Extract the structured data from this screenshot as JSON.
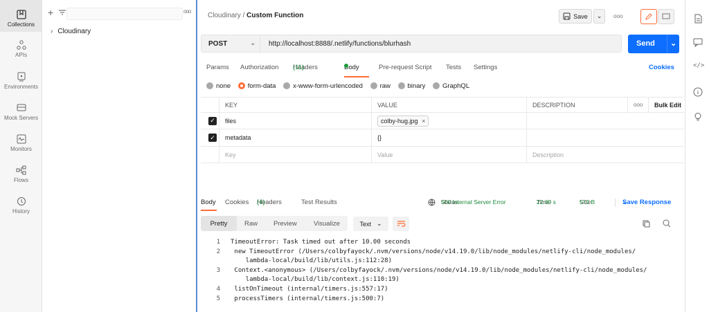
{
  "rail": {
    "items": [
      {
        "label": "Collections",
        "icon": "collections-icon"
      },
      {
        "label": "APIs",
        "icon": "apis-icon"
      },
      {
        "label": "Environments",
        "icon": "environments-icon"
      },
      {
        "label": "Mock Servers",
        "icon": "mock-servers-icon"
      },
      {
        "label": "Monitors",
        "icon": "monitors-icon"
      },
      {
        "label": "Flows",
        "icon": "flows-icon"
      },
      {
        "label": "History",
        "icon": "history-icon"
      }
    ]
  },
  "collections": {
    "tree": [
      {
        "label": "Cloudinary"
      }
    ]
  },
  "header": {
    "crumb_parent": "Cloudinary",
    "crumb_sep": "/",
    "crumb_current": "Custom Function",
    "save_label": "Save"
  },
  "request": {
    "method": "POST",
    "url": "http://localhost:8888/.netlify/functions/blurhash",
    "send_label": "Send"
  },
  "req_tabs": {
    "params": "Params",
    "authorization": "Authorization",
    "headers": "Headers",
    "headers_count": "(11)",
    "body": "Body",
    "prerequest": "Pre-request Script",
    "tests": "Tests",
    "settings": "Settings",
    "cookies": "Cookies"
  },
  "body_types": {
    "none": "none",
    "form_data": "form-data",
    "urlencoded": "x-www-form-urlencoded",
    "raw": "raw",
    "binary": "binary",
    "graphql": "GraphQL"
  },
  "table": {
    "col_key": "KEY",
    "col_value": "VALUE",
    "col_desc": "DESCRIPTION",
    "more": "ooo",
    "bulk_edit": "Bulk Edit",
    "rows": [
      {
        "key": "files",
        "value": "colby-hug.jpg",
        "remove": "×"
      },
      {
        "key": "metadata",
        "value": "{}"
      }
    ],
    "placeholder_key": "Key",
    "placeholder_value": "Value",
    "placeholder_desc": "Description"
  },
  "response": {
    "tab_body": "Body",
    "tab_cookies": "Cookies",
    "tab_headers": "Headers",
    "headers_count": "(4)",
    "tab_tests": "Test Results",
    "status_label": "Status:",
    "status_value": "500 Internal Server Error",
    "time_label": "Time:",
    "time_value": "22.69 s",
    "size_label": "Size:",
    "size_value": "572 B",
    "save_response": "Save Response",
    "view_pretty": "Pretty",
    "view_raw": "Raw",
    "view_preview": "Preview",
    "view_visualize": "Visualize",
    "format": "Text"
  },
  "code": {
    "lines": [
      {
        "n": "1",
        "t": "TimeoutError: Task timed out after 10.00 seconds"
      },
      {
        "n": "2",
        "t": " new TimeoutError (/Users/colbyfayock/.nvm/versions/node/v14.19.0/lib/node_modules/netlify-cli/node_modules/"
      },
      {
        "n": "",
        "t": "    lambda-local/build/lib/utils.js:112:28)"
      },
      {
        "n": "3",
        "t": " Context.<anonymous> (/Users/colbyfayock/.nvm/versions/node/v14.19.0/lib/node_modules/netlify-cli/node_modules/"
      },
      {
        "n": "",
        "t": "    lambda-local/build/lib/context.js:110:19)"
      },
      {
        "n": "4",
        "t": " listOnTimeout (internal/timers.js:557:17)"
      },
      {
        "n": "5",
        "t": " processTimers (internal/timers.js:500:7)"
      }
    ]
  },
  "colors": {
    "accent": "#ff6c37",
    "send": "#0d6eff",
    "status_error": "#1a8a3a",
    "save_response": "#0d6eff"
  }
}
